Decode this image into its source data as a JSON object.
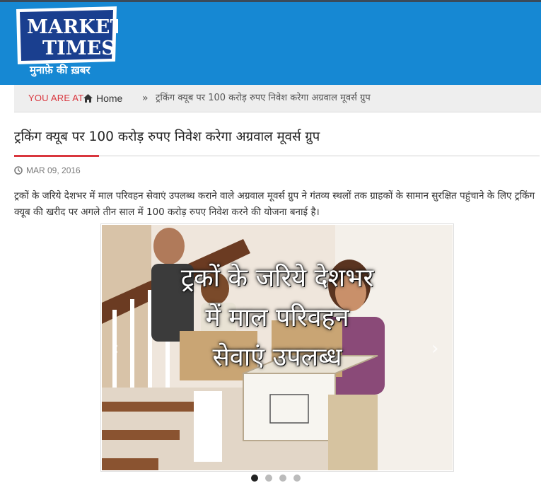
{
  "site": {
    "logo_line1": "MARKET",
    "logo_line2": "TIMES",
    "logo_tagline": "मुनाफ़े की ख़बर"
  },
  "breadcrumb": {
    "prefix": "YOU ARE AT",
    "home": "Home",
    "separator": "»",
    "current": "ट्रकिंग क्यूब पर 100 करोड़ रुपए निवेश करेगा अग्रवाल मूवर्स ग्रुप"
  },
  "article": {
    "title": "ट्रकिंग क्यूब पर 100 करोड़ रुपए निवेश करेगा अग्रवाल मूवर्स ग्रुप",
    "date": "MAR 09, 2016",
    "body": "ट्रकों के जरिये देशभर में माल परिवहन सेवाएं उपलब्ध कराने वाले अग्रवाल मूवर्स ग्रुप ने गंतव्य स्थलों तक ग्राहकों के सामान सुरक्षित पहुंचाने के लिए ट्रकिंग क्यूब की खरीद पर अगले तीन साल में 100 करोड़ रुपए निवेश करने की योजना बनाई है।"
  },
  "slider": {
    "caption_line1": "ट्रकों के जरिये देशभर",
    "caption_line2": "में माल परिवहन",
    "caption_line3": "सेवाएं उपलब्ध",
    "prev": "‹",
    "next": "›",
    "slide_count": 4,
    "active_index": 0
  },
  "colors": {
    "header_bg": "#1688d3",
    "accent_red": "#d9363e",
    "logo_blue": "#1a3f8f"
  }
}
